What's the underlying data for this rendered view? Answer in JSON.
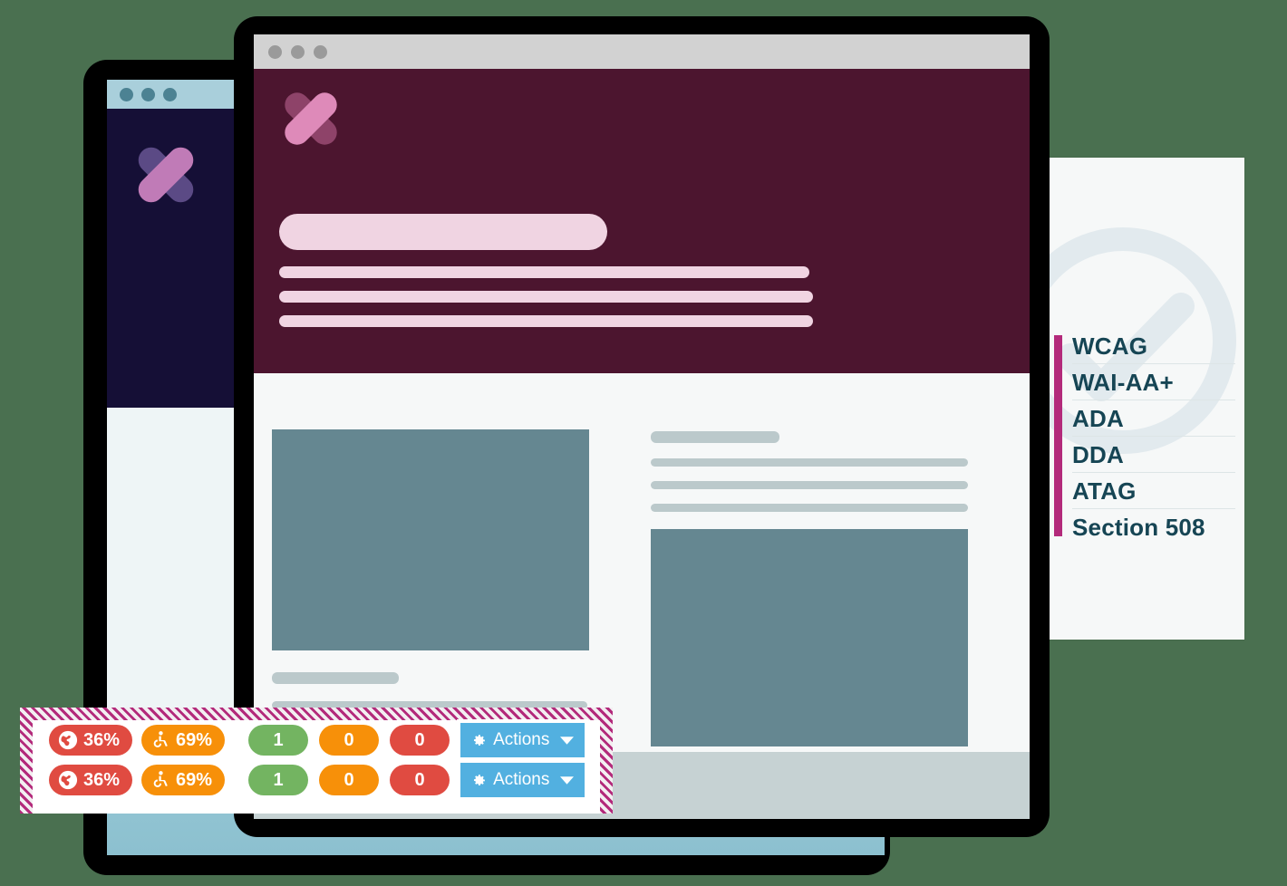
{
  "background_color": "#4a7050",
  "back_window": {
    "name": "background-app-window",
    "titlebar": {
      "dots": [
        "close",
        "minimize",
        "maximize"
      ],
      "dot_color": "#4c8293"
    },
    "nav_panel_color": "#150f36",
    "logo": {
      "icon": "x-logo-icon",
      "bar_color_front": "#c07bb7",
      "bar_color_back": "#5b4a85"
    }
  },
  "front_window": {
    "name": "foreground-app-window",
    "titlebar": {
      "dots": [
        "close",
        "minimize",
        "maximize"
      ],
      "dot_color": "#9a9a9a"
    },
    "hero": {
      "background_color": "#4c152f",
      "logo": {
        "icon": "x-logo-icon",
        "bar_color_front": "#de8ab9",
        "bar_color_back": "#8e4369"
      },
      "title_placeholder": "",
      "text_placeholder_lines": [
        "",
        "",
        ""
      ]
    },
    "content": {
      "media_blocks": [
        "hero-image-placeholder",
        "secondary-image-placeholder"
      ],
      "text_placeholder_lines": [
        "",
        "",
        "",
        "",
        "",
        "",
        ""
      ]
    }
  },
  "standards_card": {
    "name": "accessibility-standards-card",
    "accent_color": "#b32a7b",
    "text_color": "#164554",
    "watermark_icon": "speedometer-check-icon",
    "items": [
      {
        "label": "WCAG"
      },
      {
        "label": "WAI-AA+"
      },
      {
        "label": "ADA"
      },
      {
        "label": "DDA"
      },
      {
        "label": "ATAG"
      },
      {
        "label": "Section 508"
      }
    ]
  },
  "stats_panel": {
    "name": "accessibility-scores-panel",
    "border_style": "diagonal-hatch",
    "border_color": "#b32a7b",
    "rows": [
      {
        "globe_icon": "globe-icon",
        "globe_score": "36%",
        "globe_color": "#e04b41",
        "access_icon": "wheelchair-icon",
        "access_score": "69%",
        "access_color": "#f79009",
        "counts": [
          {
            "value": "1",
            "color": "#73b461"
          },
          {
            "value": "0",
            "color": "#f79009"
          },
          {
            "value": "0",
            "color": "#e04b41"
          }
        ],
        "actions_label": "Actions",
        "actions_color": "#52b0e0"
      },
      {
        "globe_icon": "globe-icon",
        "globe_score": "36%",
        "globe_color": "#e04b41",
        "access_icon": "wheelchair-icon",
        "access_score": "69%",
        "access_color": "#f79009",
        "counts": [
          {
            "value": "1",
            "color": "#73b461"
          },
          {
            "value": "0",
            "color": "#f79009"
          },
          {
            "value": "0",
            "color": "#e04b41"
          }
        ],
        "actions_label": "Actions",
        "actions_color": "#52b0e0"
      }
    ]
  }
}
